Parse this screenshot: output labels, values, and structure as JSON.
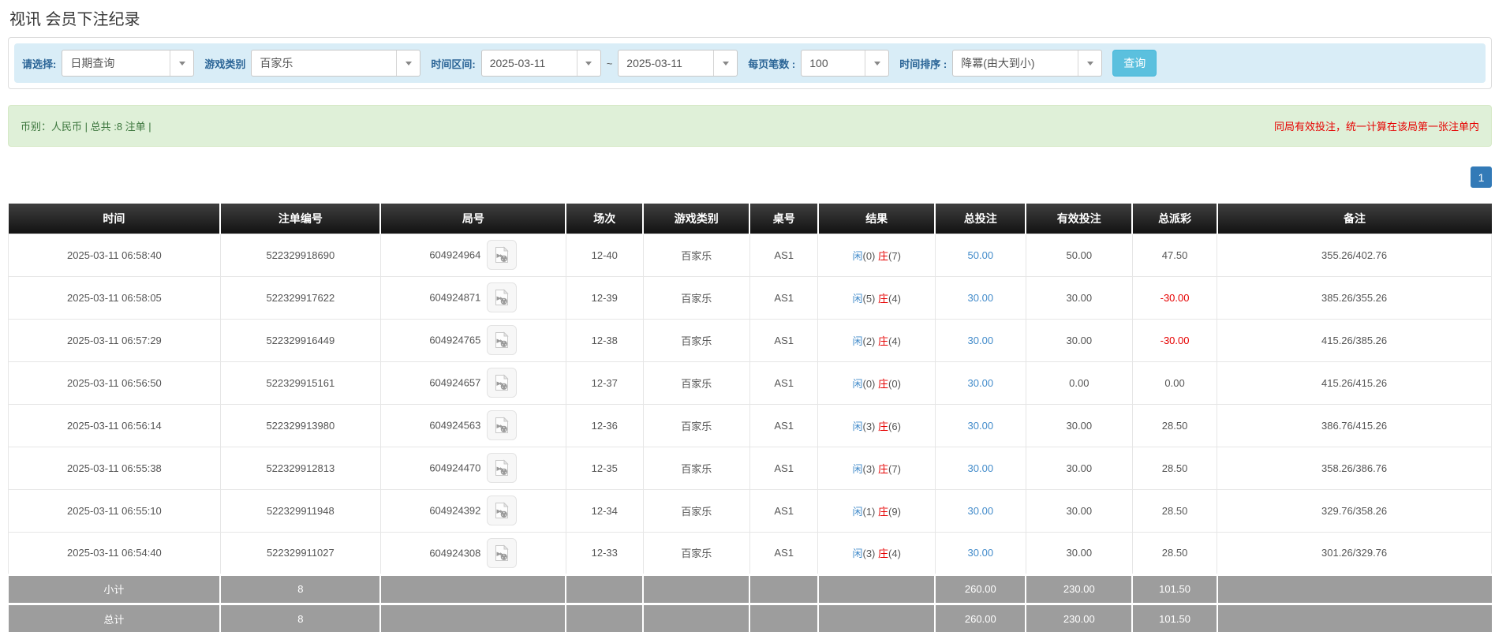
{
  "page": {
    "title": "视讯 会员下注纪录"
  },
  "filters": {
    "query_type_label": "请选择:",
    "query_type_value": "日期查询",
    "game_type_label": "游戏类别",
    "game_type_value": "百家乐",
    "time_range_label": "时间区间:",
    "date_from": "2025-03-11",
    "tilde": "~",
    "date_to": "2025-03-11",
    "page_size_label": "每页笔数 :",
    "page_size_value": "100",
    "sort_label": "时间排序 :",
    "sort_value": "降冪(由大到小)",
    "search_button": "查询"
  },
  "summary_bar": {
    "left_text": "币别：人民币 | 总共 :8 注单 |",
    "right_notice": "同局有效投注，统一计算在该局第一张注单内"
  },
  "pagination": {
    "current_page": "1"
  },
  "icons": {
    "select_caret": "chevron-down-icon",
    "round_media": "video-file-icon"
  },
  "colors": {
    "accent_blue": "#428bca",
    "banker_red": "#e60000",
    "negative_red": "#e60000",
    "search_button_bg": "#5bc0de",
    "header_bg": "#1a1a1a",
    "footer_bg": "#9d9d9d",
    "filter_bar_bg": "#d9edf7",
    "summary_bar_bg": "#dff0d8",
    "pagination_bg": "#337ab7"
  },
  "table": {
    "headers": [
      "时间",
      "注单编号",
      "局号",
      "场次",
      "游戏类别",
      "桌号",
      "结果",
      "总投注",
      "有效投注",
      "总派彩",
      "备注"
    ],
    "rows": [
      {
        "time": "2025-03-11 06:58:40",
        "bet_id": "522329918690",
        "round_id": "604924964",
        "session": "12-40",
        "game": "百家乐",
        "table_no": "AS1",
        "player": "闲",
        "player_score": "0",
        "banker": "庄",
        "banker_score": "7",
        "total_bet": "50.00",
        "valid_bet": "50.00",
        "payout": "47.50",
        "remark": "355.26/402.76"
      },
      {
        "time": "2025-03-11 06:58:05",
        "bet_id": "522329917622",
        "round_id": "604924871",
        "session": "12-39",
        "game": "百家乐",
        "table_no": "AS1",
        "player": "闲",
        "player_score": "5",
        "banker": "庄",
        "banker_score": "4",
        "total_bet": "30.00",
        "valid_bet": "30.00",
        "payout": "-30.00",
        "remark": "385.26/355.26"
      },
      {
        "time": "2025-03-11 06:57:29",
        "bet_id": "522329916449",
        "round_id": "604924765",
        "session": "12-38",
        "game": "百家乐",
        "table_no": "AS1",
        "player": "闲",
        "player_score": "2",
        "banker": "庄",
        "banker_score": "4",
        "total_bet": "30.00",
        "valid_bet": "30.00",
        "payout": "-30.00",
        "remark": "415.26/385.26"
      },
      {
        "time": "2025-03-11 06:56:50",
        "bet_id": "522329915161",
        "round_id": "604924657",
        "session": "12-37",
        "game": "百家乐",
        "table_no": "AS1",
        "player": "闲",
        "player_score": "0",
        "banker": "庄",
        "banker_score": "0",
        "total_bet": "30.00",
        "valid_bet": "0.00",
        "payout": "0.00",
        "remark": "415.26/415.26"
      },
      {
        "time": "2025-03-11 06:56:14",
        "bet_id": "522329913980",
        "round_id": "604924563",
        "session": "12-36",
        "game": "百家乐",
        "table_no": "AS1",
        "player": "闲",
        "player_score": "3",
        "banker": "庄",
        "banker_score": "6",
        "total_bet": "30.00",
        "valid_bet": "30.00",
        "payout": "28.50",
        "remark": "386.76/415.26"
      },
      {
        "time": "2025-03-11 06:55:38",
        "bet_id": "522329912813",
        "round_id": "604924470",
        "session": "12-35",
        "game": "百家乐",
        "table_no": "AS1",
        "player": "闲",
        "player_score": "3",
        "banker": "庄",
        "banker_score": "7",
        "total_bet": "30.00",
        "valid_bet": "30.00",
        "payout": "28.50",
        "remark": "358.26/386.76"
      },
      {
        "time": "2025-03-11 06:55:10",
        "bet_id": "522329911948",
        "round_id": "604924392",
        "session": "12-34",
        "game": "百家乐",
        "table_no": "AS1",
        "player": "闲",
        "player_score": "1",
        "banker": "庄",
        "banker_score": "9",
        "total_bet": "30.00",
        "valid_bet": "30.00",
        "payout": "28.50",
        "remark": "329.76/358.26"
      },
      {
        "time": "2025-03-11 06:54:40",
        "bet_id": "522329911027",
        "round_id": "604924308",
        "session": "12-33",
        "game": "百家乐",
        "table_no": "AS1",
        "player": "闲",
        "player_score": "3",
        "banker": "庄",
        "banker_score": "4",
        "total_bet": "30.00",
        "valid_bet": "30.00",
        "payout": "28.50",
        "remark": "301.26/329.76"
      }
    ],
    "subtotal": {
      "label": "小计",
      "count": "8",
      "total_bet": "260.00",
      "valid_bet": "230.00",
      "payout": "101.50"
    },
    "total": {
      "label": "总计",
      "count": "8",
      "total_bet": "260.00",
      "valid_bet": "230.00",
      "payout": "101.50"
    }
  }
}
